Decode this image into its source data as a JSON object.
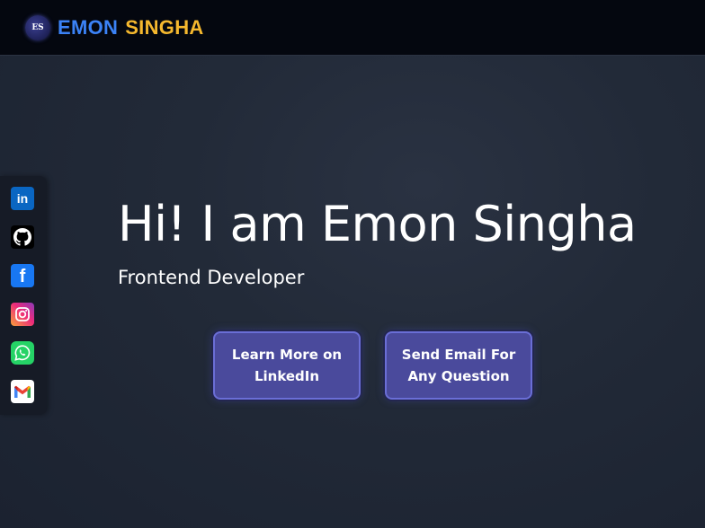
{
  "navbar": {
    "logo_initials": "ES",
    "brand_first": "EMON",
    "brand_last": "SINGHA"
  },
  "social": [
    {
      "name": "linkedin",
      "icon": "linkedin-icon",
      "glyph": "in",
      "color": "#0a66c2"
    },
    {
      "name": "github",
      "icon": "github-icon",
      "color": "#000000"
    },
    {
      "name": "facebook",
      "icon": "facebook-icon",
      "glyph": "f",
      "color": "#1877f2"
    },
    {
      "name": "instagram",
      "icon": "instagram-icon",
      "color": "#ee2a7b"
    },
    {
      "name": "whatsapp",
      "icon": "whatsapp-icon",
      "color": "#25d366"
    },
    {
      "name": "gmail",
      "icon": "gmail-icon",
      "color": "#ffffff"
    }
  ],
  "hero": {
    "title": "Hi! I am Emon Singha",
    "subtitle": "Frontend Developer"
  },
  "buttons": {
    "linkedin_label": "Learn More on LinkedIn",
    "email_label": "Send Email For Any Question"
  },
  "colors": {
    "brand_blue": "#3b82f6",
    "brand_gold": "#f5b82e",
    "button_fill": "#4a4a9c",
    "button_border": "#6a6ed6"
  }
}
